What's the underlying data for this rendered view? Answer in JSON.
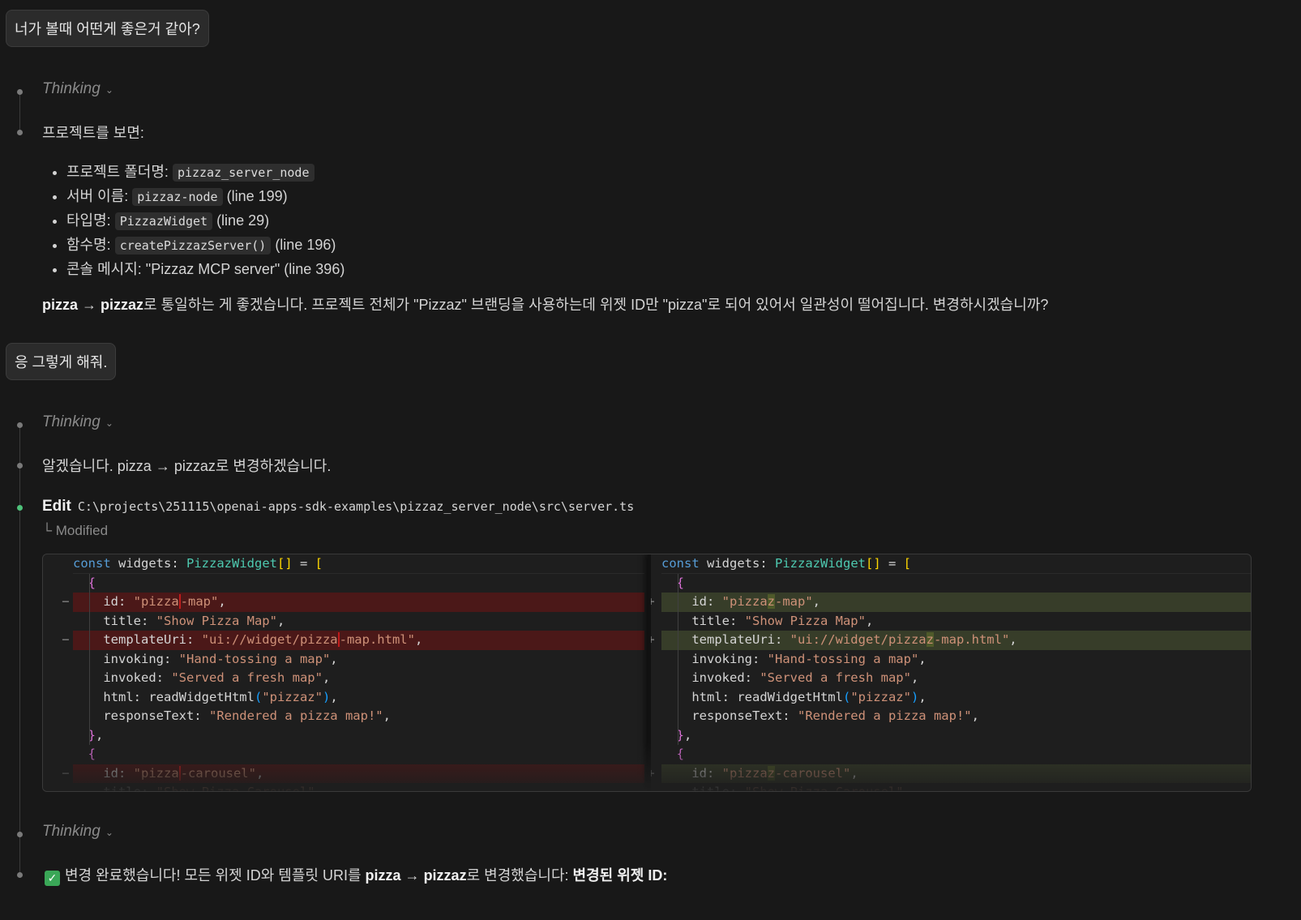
{
  "messages": {
    "user1": "너가 볼때 어떤게 좋은거 같아?",
    "thinking_label": "Thinking",
    "reply1_intro": "프로젝트를 보면:",
    "reply1_items": [
      {
        "label": "프로젝트 폴더명: ",
        "code": "pizzaz_server_node",
        "suffix": ""
      },
      {
        "label": "서버 이름: ",
        "code": "pizzaz-node",
        "suffix": " (line 199)"
      },
      {
        "label": "타입명: ",
        "code": "PizzazWidget",
        "suffix": " (line 29)"
      },
      {
        "label": "함수명: ",
        "code": "createPizzazServer()",
        "suffix": " (line 196)"
      },
      {
        "label": "콘솔 메시지: \"Pizzaz MCP server\" (line 396)",
        "code": "",
        "suffix": ""
      }
    ],
    "reply1_conclusion": {
      "b1": "pizza",
      "arrow": " → ",
      "b2": "pizzaz",
      "rest": "로 통일하는 게 좋겠습니다. 프로젝트 전체가 \"Pizzaz\" 브랜딩을 사용하는데 위젯 ID만 \"pizza\"로 되어 있어서 일관성이 떨어집니다. 변경하시겠습니까?"
    },
    "user2": "응 그렇게 해줘.",
    "reply2": "알겠습니다. pizza → pizzaz로 변경하겠습니다.",
    "edit": {
      "label": "Edit",
      "path": "C:\\projects\\251115\\openai-apps-sdk-examples\\pizzaz_server_node\\src\\server.ts",
      "status": "└ Modified"
    },
    "final": {
      "t1": "변경 완료했습니다! 모든 위젯 ID와 템플릿 URI를 ",
      "b1": "pizza",
      "arrow": " → ",
      "b2": "pizzaz",
      "t2": "로 변경했습니다: ",
      "b3": "변경된 위젯 ID:"
    }
  },
  "colors": {
    "accent_green": "#4ec27a",
    "removed_bg": "#4b1818",
    "added_bg": "#373d29"
  },
  "icons": {
    "thinking": "chevron-down-icon",
    "final": "check-box-icon"
  },
  "diff": {
    "left": [
      {
        "type": "ctx",
        "gutter": "",
        "tokens": [
          [
            "const",
            "kw"
          ],
          [
            " widgets: ",
            "pl"
          ],
          [
            "PizzazWidget",
            "ty"
          ],
          [
            "[]",
            "br"
          ],
          [
            " = ",
            "pl"
          ],
          [
            "[",
            "br"
          ]
        ]
      },
      {
        "type": "ctx",
        "gutter": "",
        "tokens": [
          [
            "  ",
            "pl"
          ],
          [
            "{",
            "mg"
          ]
        ]
      },
      {
        "type": "del",
        "gutter": "−",
        "tokens": [
          [
            "    id: ",
            "pl"
          ],
          [
            "\"pizza",
            "st"
          ],
          [
            "-map\"",
            "st hl-del"
          ],
          [
            ",",
            "pl"
          ]
        ]
      },
      {
        "type": "ctx",
        "gutter": "",
        "tokens": [
          [
            "    title: ",
            "pl"
          ],
          [
            "\"Show Pizza Map\"",
            "st"
          ],
          [
            ",",
            "pl"
          ]
        ]
      },
      {
        "type": "del",
        "gutter": "−",
        "tokens": [
          [
            "    templateUri: ",
            "pl"
          ],
          [
            "\"ui://widget/pizza",
            "st"
          ],
          [
            "-map.html\"",
            "st hl-del"
          ],
          [
            ",",
            "pl"
          ]
        ]
      },
      {
        "type": "ctx",
        "gutter": "",
        "tokens": [
          [
            "    invoking: ",
            "pl"
          ],
          [
            "\"Hand-tossing a map\"",
            "st"
          ],
          [
            ",",
            "pl"
          ]
        ]
      },
      {
        "type": "ctx",
        "gutter": "",
        "tokens": [
          [
            "    invoked: ",
            "pl"
          ],
          [
            "\"Served a fresh map\"",
            "st"
          ],
          [
            ",",
            "pl"
          ]
        ]
      },
      {
        "type": "ctx",
        "gutter": "",
        "tokens": [
          [
            "    html: readWidgetHtml",
            "pl"
          ],
          [
            "(",
            "bl"
          ],
          [
            "\"pizzaz\"",
            "st"
          ],
          [
            ")",
            "bl"
          ],
          [
            ",",
            "pl"
          ]
        ]
      },
      {
        "type": "ctx",
        "gutter": "",
        "tokens": [
          [
            "    responseText: ",
            "pl"
          ],
          [
            "\"Rendered a pizza map!\"",
            "st"
          ],
          [
            ",",
            "pl"
          ]
        ]
      },
      {
        "type": "ctx",
        "gutter": "",
        "tokens": [
          [
            "  ",
            "pl"
          ],
          [
            "}",
            "mg"
          ],
          [
            ",",
            "pl"
          ]
        ]
      },
      {
        "type": "ctx",
        "gutter": "",
        "tokens": [
          [
            "  ",
            "pl"
          ],
          [
            "{",
            "mg"
          ]
        ]
      },
      {
        "type": "del",
        "gutter": "−",
        "tokens": [
          [
            "    id: ",
            "pl"
          ],
          [
            "\"pizza",
            "st"
          ],
          [
            "-carousel\"",
            "st hl-del"
          ],
          [
            ",",
            "pl"
          ]
        ]
      },
      {
        "type": "ctx",
        "gutter": "",
        "tokens": [
          [
            "    title: ",
            "pl"
          ],
          [
            "\"Show Pizza Carousel\"",
            "st"
          ],
          [
            ",",
            "pl"
          ]
        ]
      }
    ],
    "right": [
      {
        "type": "ctx",
        "gutter": "",
        "tokens": [
          [
            "const",
            "kw"
          ],
          [
            " widgets: ",
            "pl"
          ],
          [
            "PizzazWidget",
            "ty"
          ],
          [
            "[]",
            "br"
          ],
          [
            " = ",
            "pl"
          ],
          [
            "[",
            "br"
          ]
        ]
      },
      {
        "type": "ctx",
        "gutter": "",
        "tokens": [
          [
            "  ",
            "pl"
          ],
          [
            "{",
            "mg"
          ]
        ]
      },
      {
        "type": "add",
        "gutter": "+",
        "tokens": [
          [
            "    id: ",
            "pl"
          ],
          [
            "\"pizza",
            "st"
          ],
          [
            "z",
            "st hl-add"
          ],
          [
            "-map\"",
            "st"
          ],
          [
            ",",
            "pl"
          ]
        ]
      },
      {
        "type": "ctx",
        "gutter": "",
        "tokens": [
          [
            "    title: ",
            "pl"
          ],
          [
            "\"Show Pizza Map\"",
            "st"
          ],
          [
            ",",
            "pl"
          ]
        ]
      },
      {
        "type": "add",
        "gutter": "+",
        "tokens": [
          [
            "    templateUri: ",
            "pl"
          ],
          [
            "\"ui://widget/pizza",
            "st"
          ],
          [
            "z",
            "st hl-add"
          ],
          [
            "-map.html\"",
            "st"
          ],
          [
            ",",
            "pl"
          ]
        ]
      },
      {
        "type": "ctx",
        "gutter": "",
        "tokens": [
          [
            "    invoking: ",
            "pl"
          ],
          [
            "\"Hand-tossing a map\"",
            "st"
          ],
          [
            ",",
            "pl"
          ]
        ]
      },
      {
        "type": "ctx",
        "gutter": "",
        "tokens": [
          [
            "    invoked: ",
            "pl"
          ],
          [
            "\"Served a fresh map\"",
            "st"
          ],
          [
            ",",
            "pl"
          ]
        ]
      },
      {
        "type": "ctx",
        "gutter": "",
        "tokens": [
          [
            "    html: readWidgetHtml",
            "pl"
          ],
          [
            "(",
            "bl"
          ],
          [
            "\"pizzaz\"",
            "st"
          ],
          [
            ")",
            "bl"
          ],
          [
            ",",
            "pl"
          ]
        ]
      },
      {
        "type": "ctx",
        "gutter": "",
        "tokens": [
          [
            "    responseText: ",
            "pl"
          ],
          [
            "\"Rendered a pizza map!\"",
            "st"
          ],
          [
            ",",
            "pl"
          ]
        ]
      },
      {
        "type": "ctx",
        "gutter": "",
        "tokens": [
          [
            "  ",
            "pl"
          ],
          [
            "}",
            "mg"
          ],
          [
            ",",
            "pl"
          ]
        ]
      },
      {
        "type": "ctx",
        "gutter": "",
        "tokens": [
          [
            "  ",
            "pl"
          ],
          [
            "{",
            "mg"
          ]
        ]
      },
      {
        "type": "add",
        "gutter": "+",
        "tokens": [
          [
            "    id: ",
            "pl"
          ],
          [
            "\"pizza",
            "st"
          ],
          [
            "z",
            "st hl-add"
          ],
          [
            "-carousel\"",
            "st"
          ],
          [
            ",",
            "pl"
          ]
        ]
      },
      {
        "type": "ctx",
        "gutter": "",
        "tokens": [
          [
            "    title: ",
            "pl"
          ],
          [
            "\"Show Pizza Carousel\"",
            "st"
          ],
          [
            ",",
            "pl"
          ]
        ]
      }
    ]
  }
}
